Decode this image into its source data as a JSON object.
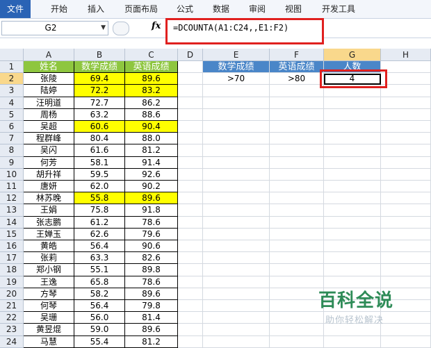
{
  "ribbon": {
    "tabs": [
      "文件",
      "开始",
      "插入",
      "页面布局",
      "公式",
      "数据",
      "审阅",
      "视图",
      "开发工具"
    ]
  },
  "formula_bar": {
    "name_box": "G2",
    "fx": "fx",
    "formula": "=DCOUNTA(A1:C24,,E1:F2)"
  },
  "columns": [
    "A",
    "B",
    "C",
    "D",
    "E",
    "F",
    "G",
    "H"
  ],
  "rows": [
    "1",
    "2",
    "3",
    "4",
    "5",
    "6",
    "7",
    "8",
    "9",
    "10",
    "11",
    "12",
    "13",
    "14",
    "15",
    "16",
    "17",
    "18",
    "19",
    "20",
    "21",
    "22",
    "23",
    "24"
  ],
  "table": {
    "headers": [
      "姓名",
      "数学成绩",
      "英语成绩"
    ],
    "records": [
      [
        "张陵",
        "69.4",
        "89.6"
      ],
      [
        "陆婷",
        "72.2",
        "83.2"
      ],
      [
        "汪明道",
        "72.7",
        "86.2"
      ],
      [
        "周杨",
        "63.2",
        "88.6"
      ],
      [
        "吴超",
        "60.6",
        "90.4"
      ],
      [
        "程群峰",
        "80.4",
        "88.0"
      ],
      [
        "吴闪",
        "61.6",
        "81.2"
      ],
      [
        "何芳",
        "58.1",
        "91.4"
      ],
      [
        "胡升祥",
        "59.5",
        "92.6"
      ],
      [
        "唐妍",
        "62.0",
        "90.2"
      ],
      [
        "林苏晚",
        "55.8",
        "89.6"
      ],
      [
        "王娟",
        "75.8",
        "91.8"
      ],
      [
        "张志鹏",
        "61.2",
        "78.6"
      ],
      [
        "王婵玉",
        "62.6",
        "79.6"
      ],
      [
        "黄皓",
        "56.4",
        "90.6"
      ],
      [
        "张莉",
        "63.3",
        "82.6"
      ],
      [
        "郑小钢",
        "55.1",
        "89.8"
      ],
      [
        "王逸",
        "65.8",
        "78.6"
      ],
      [
        "方琴",
        "58.2",
        "89.6"
      ],
      [
        "何琴",
        "56.4",
        "79.8"
      ],
      [
        "吴珊",
        "56.0",
        "81.4"
      ],
      [
        "黄昱焜",
        "59.0",
        "89.6"
      ],
      [
        "马慧",
        "55.4",
        "81.2"
      ]
    ],
    "highlighted_rows": [
      1,
      2,
      5,
      11
    ]
  },
  "criteria": {
    "headers": [
      "数学成绩",
      "英语成绩",
      "人数"
    ],
    "values": [
      ">70",
      ">80",
      "4"
    ]
  },
  "colors": {
    "header_green": "#8ec63f",
    "criteria_blue": "#4a86c8",
    "highlight_yellow": "#ffff00",
    "callout_red": "#e0201f"
  },
  "watermark": {
    "title": "百科全说",
    "subtitle": "助你轻松解决"
  }
}
